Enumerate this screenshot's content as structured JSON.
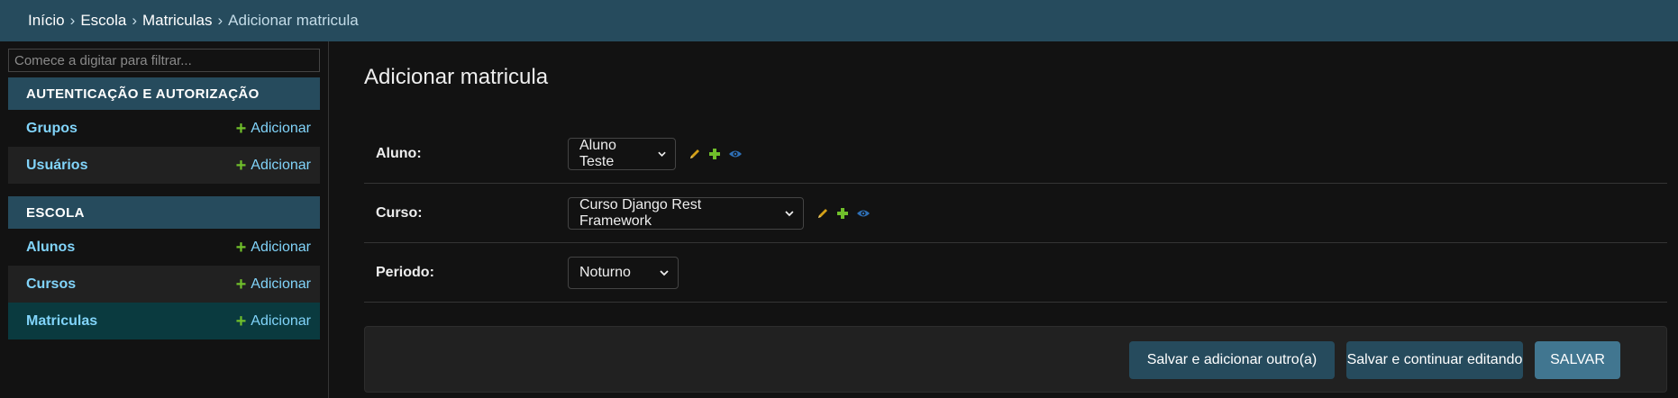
{
  "breadcrumb": {
    "items": [
      "Início",
      "Escola",
      "Matriculas"
    ],
    "separator": "›",
    "current": "Adicionar matricula"
  },
  "sidebar": {
    "filter_placeholder": "Comece a digitar para filtrar...",
    "modules": [
      {
        "title": "AUTENTICAÇÃO E AUTORIZAÇÃO",
        "models": [
          {
            "name": "Grupos",
            "add": "Adicionar"
          },
          {
            "name": "Usuários",
            "add": "Adicionar"
          }
        ]
      },
      {
        "title": "ESCOLA",
        "models": [
          {
            "name": "Alunos",
            "add": "Adicionar"
          },
          {
            "name": "Cursos",
            "add": "Adicionar"
          },
          {
            "name": "Matriculas",
            "add": "Adicionar",
            "active": true
          }
        ]
      }
    ]
  },
  "main": {
    "title": "Adicionar matricula",
    "fields": [
      {
        "label": "Aluno:",
        "value": "Aluno Teste",
        "icons": [
          "pencil-icon",
          "plus-icon",
          "eye-icon"
        ]
      },
      {
        "label": "Curso:",
        "value": "Curso Django Rest Framework",
        "icons": [
          "pencil-icon",
          "plus-icon",
          "eye-icon"
        ]
      },
      {
        "label": "Periodo:",
        "value": "Noturno",
        "icons": []
      }
    ],
    "buttons": {
      "save_add": "Salvar e adicionar outro(a)",
      "save_continue": "Salvar e continuar editando",
      "save": "SALVAR"
    }
  },
  "colors": {
    "header": "#264b5d",
    "link": "#81d4fa",
    "add_green": "#70bf2b",
    "pencil_yellow": "#d4a017",
    "eye_blue": "#2e6fb5",
    "primary_button": "#417690"
  }
}
